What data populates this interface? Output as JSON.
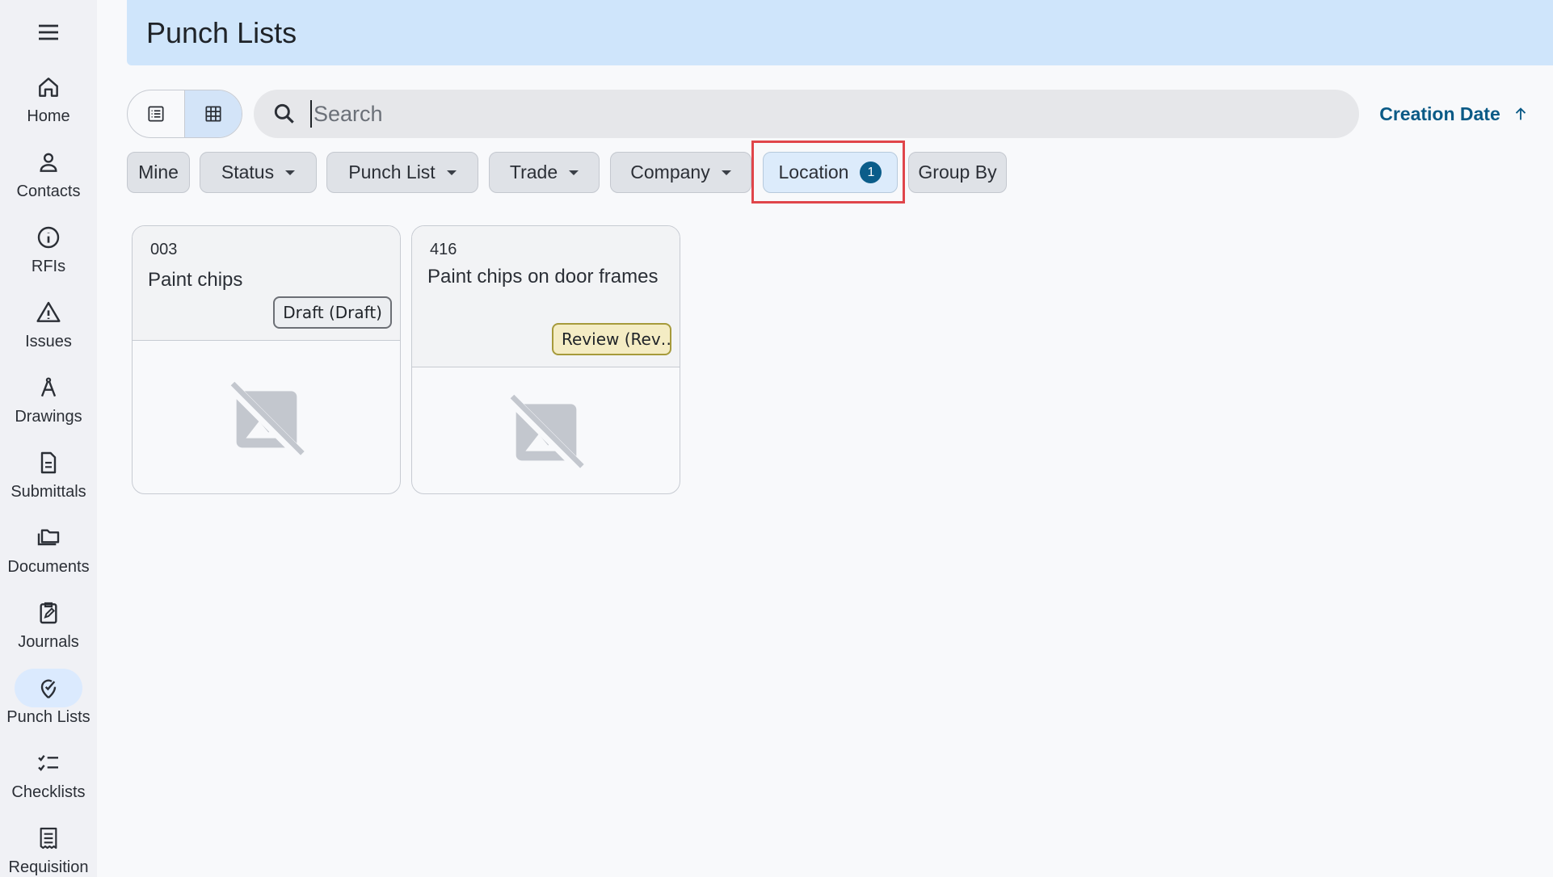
{
  "nav": {
    "items": [
      {
        "label": "Home",
        "icon": "home-icon"
      },
      {
        "label": "Contacts",
        "icon": "person-icon"
      },
      {
        "label": "RFIs",
        "icon": "info-icon"
      },
      {
        "label": "Issues",
        "icon": "warning-icon"
      },
      {
        "label": "Drawings",
        "icon": "compass-icon"
      },
      {
        "label": "Submittals",
        "icon": "document-icon"
      },
      {
        "label": "Documents",
        "icon": "folder-icon"
      },
      {
        "label": "Journals",
        "icon": "clipboard-edit-icon"
      },
      {
        "label": "Punch Lists",
        "icon": "punch-pin-icon",
        "active": true
      },
      {
        "label": "Checklists",
        "icon": "checklist-icon"
      },
      {
        "label": "Requisition",
        "icon": "receipt-icon"
      }
    ]
  },
  "header": {
    "title": "Punch Lists"
  },
  "toolbar": {
    "search_placeholder": "Search",
    "search_value": "",
    "sort_label": "Creation Date",
    "view_mode": "grid"
  },
  "filters": {
    "mine": "Mine",
    "status": "Status",
    "punch_list": "Punch List",
    "trade": "Trade",
    "company": "Company",
    "location": "Location",
    "location_count": "1",
    "group_by": "Group By"
  },
  "cards": [
    {
      "number": "003",
      "title": "Paint chips",
      "status": "Draft (Draft)"
    },
    {
      "number": "416",
      "title": "Paint chips on door frames",
      "status": "Review (Rev…"
    }
  ],
  "colors": {
    "accent": "#0a5a86",
    "header_bg": "#cfe5fb",
    "highlight": "#e0454a",
    "review_bg": "#f4ecc4"
  }
}
